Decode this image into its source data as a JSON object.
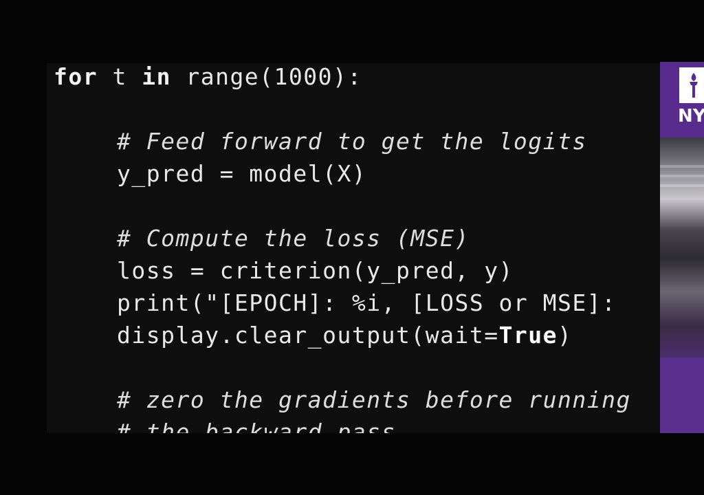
{
  "code": {
    "line1": {
      "kw_for": "for",
      "var": " t ",
      "kw_in": "in",
      "rest": " range(1000):"
    },
    "line2": "# Feed forward to get the logits",
    "line3": "y_pred = model(X)",
    "line4": "# Compute the loss (MSE)",
    "line5": "loss = criterion(y_pred, y)",
    "line6": "print(\"[EPOCH]: %i, [LOSS or MSE]:",
    "line7": {
      "pre": "display.clear_output(wait=",
      "bold": "True",
      "post": ")"
    },
    "line8": "# zero the gradients before running",
    "line9": "# the backward pass"
  },
  "slide": {
    "logo_text": "NYU",
    "torch_icon": "torch-icon",
    "colors": {
      "nyu_purple": "#5a2b8f",
      "code_bg": "#0d0e0d"
    }
  }
}
